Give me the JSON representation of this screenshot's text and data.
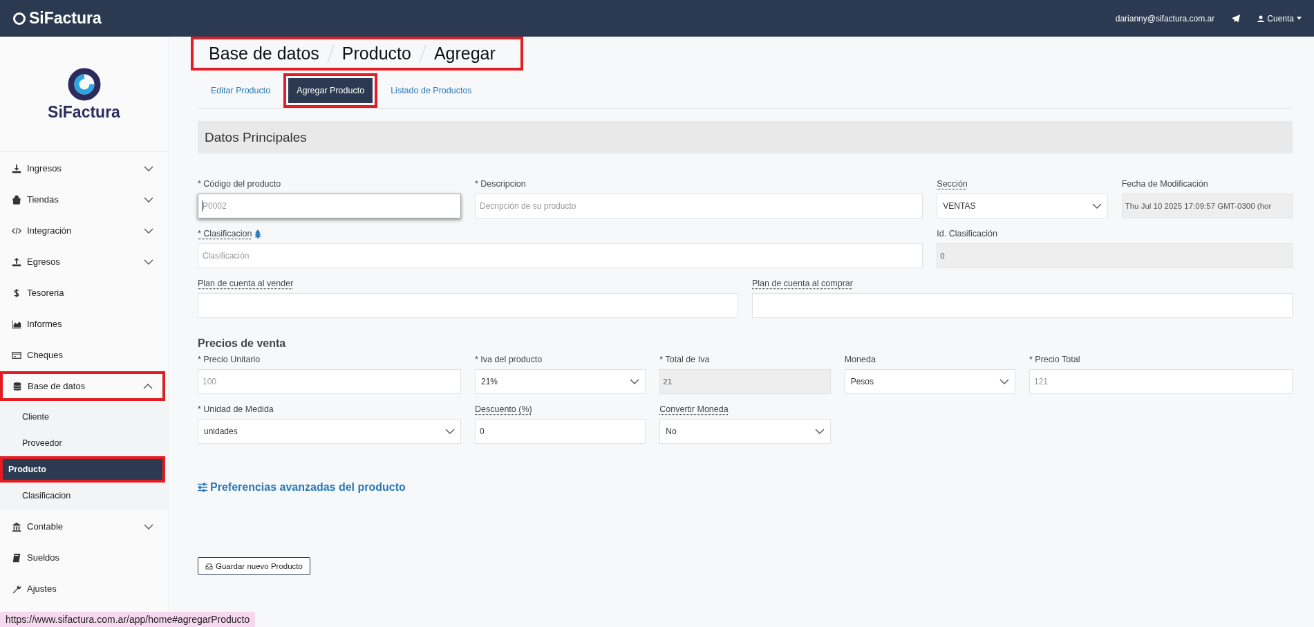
{
  "topbar": {
    "brand": "SiFactura",
    "email": "darianny@sifactura.com.ar",
    "account": "Cuenta"
  },
  "sidebar": {
    "brand": "SiFactura",
    "items": [
      {
        "label": "Ingresos",
        "expanded": false,
        "highlighted": false
      },
      {
        "label": "Tiendas",
        "expanded": false,
        "highlighted": false
      },
      {
        "label": "Integración",
        "expanded": false,
        "highlighted": false
      },
      {
        "label": "Egresos",
        "expanded": false,
        "highlighted": false
      },
      {
        "label": "Tesoreria",
        "highlighted": false
      },
      {
        "label": "Informes",
        "highlighted": false
      },
      {
        "label": "Cheques",
        "highlighted": false
      },
      {
        "label": "Base de datos",
        "expanded": true,
        "highlighted": true,
        "children": [
          {
            "label": "Cliente",
            "selected": false,
            "highlighted": false
          },
          {
            "label": "Proveedor",
            "selected": false,
            "highlighted": false
          },
          {
            "label": "Producto",
            "selected": true,
            "highlighted": true
          },
          {
            "label": "Clasificacion",
            "selected": false,
            "highlighted": false
          }
        ]
      },
      {
        "label": "Contable",
        "expanded": false,
        "highlighted": false
      },
      {
        "label": "Sueldos",
        "highlighted": false
      },
      {
        "label": "Ajustes",
        "highlighted": false
      }
    ]
  },
  "breadcrumb": {
    "highlighted": true,
    "items": [
      "Base de datos",
      "Producto",
      "Agregar"
    ]
  },
  "tabs": [
    {
      "label": "Editar Producto",
      "selected": false,
      "highlighted": false
    },
    {
      "label": "Agregar Producto",
      "selected": true,
      "highlighted": true
    },
    {
      "label": "Listado de Productos",
      "selected": false,
      "highlighted": false
    }
  ],
  "section_title": "Datos Principales",
  "rows": [
    [
      {
        "label": "* Código del producto",
        "kind": "text",
        "placeholder": "P0002",
        "focused": true,
        "tooltip": false
      },
      {
        "label": "* Descripcion",
        "kind": "text",
        "placeholder": "Decripción de su producto",
        "focused": false,
        "tooltip": false
      },
      {
        "label": "Sección",
        "kind": "select",
        "value": "VENTAS",
        "tooltip": true
      },
      {
        "label": "Fecha de Modificación",
        "kind": "readonly",
        "value": "Thu Jul 10 2025 17:09:57 GMT-0300 (hor",
        "tooltip": false
      }
    ],
    [
      {
        "label": "* Clasificacion",
        "kind": "text",
        "placeholder": "Clasificación",
        "focused": false,
        "tooltip": true,
        "tree_icon": true
      },
      {
        "label": "Id. Clasificación",
        "kind": "readonly",
        "value": "0",
        "tooltip": false
      }
    ],
    [
      {
        "label": "Plan de cuenta al vender",
        "kind": "text",
        "focused": false,
        "tooltip": true
      },
      {
        "label": "Plan de cuenta al comprar",
        "kind": "text",
        "focused": false,
        "tooltip": true
      }
    ]
  ],
  "prices_title": "Precios de venta",
  "price_rows": [
    [
      {
        "label": "* Precio Unitario",
        "kind": "text",
        "placeholder": "100",
        "focused": false,
        "tooltip": false
      },
      {
        "label": "* Iva del producto",
        "kind": "select",
        "value": "21%",
        "tooltip": false
      },
      {
        "label": "* Total de Iva",
        "kind": "readonly",
        "value": "21",
        "tooltip": false
      },
      {
        "label": "Moneda",
        "kind": "select",
        "value": "Pesos",
        "tooltip": false
      },
      {
        "label": "* Precio Total",
        "kind": "text",
        "placeholder": "121",
        "focused": false,
        "tooltip": false
      }
    ],
    [
      {
        "label": "* Unidad de Medida",
        "kind": "select",
        "value": "unidades",
        "tooltip": false
      },
      {
        "label": "Descuento (%)",
        "kind": "text",
        "value": "0",
        "focused": false,
        "tooltip": true
      },
      {
        "label": "Convertir Moneda",
        "kind": "select",
        "value": "No",
        "tooltip": true
      }
    ]
  ],
  "advanced_link": "Preferencias avanzadas del producto",
  "save_button": "Guardar nuevo Producto",
  "status_url": "https://www.sifactura.com.ar/app/home#agregarProducto"
}
